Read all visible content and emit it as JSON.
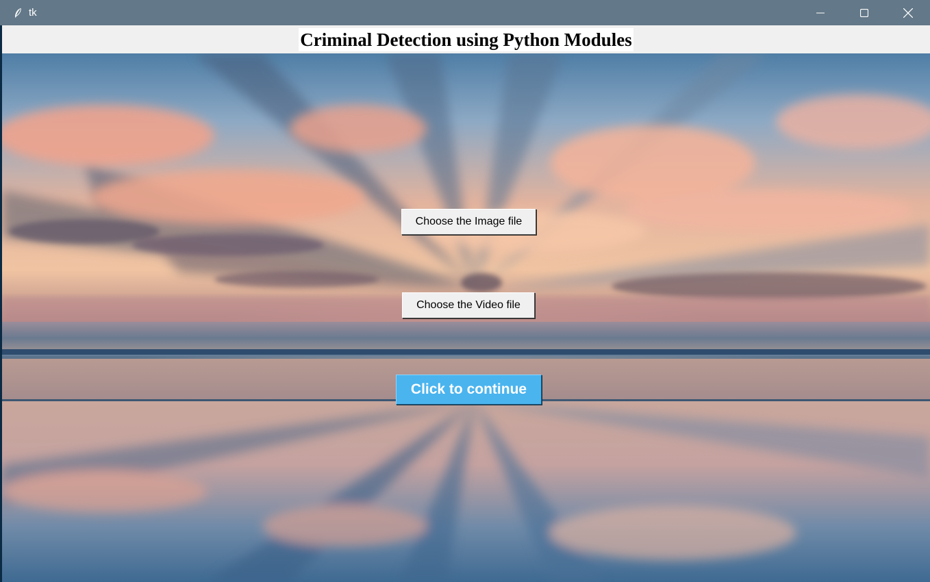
{
  "window": {
    "title": "tk",
    "icon": "feather-icon",
    "controls": {
      "minimize": "minimize-icon",
      "maximize": "maximize-icon",
      "close": "close-icon"
    }
  },
  "header": {
    "title": "Criminal Detection using Python Modules"
  },
  "buttons": {
    "choose_image": "Choose the Image file",
    "choose_video": "Choose the Video file",
    "continue": "Click to continue"
  },
  "colors": {
    "titlebar": "#637888",
    "continue_button": "#4ab4ee"
  }
}
